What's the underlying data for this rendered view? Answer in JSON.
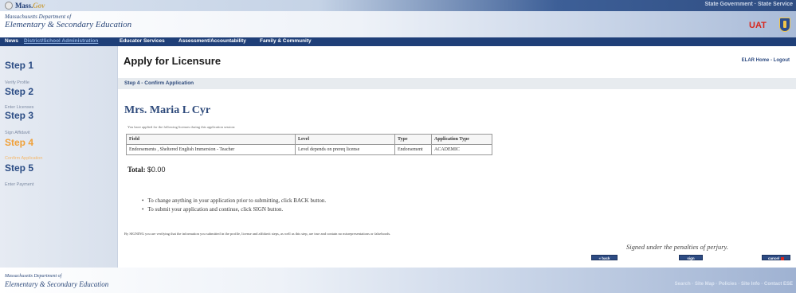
{
  "topbar": {
    "logo_text": "Mass.",
    "logo_accent": "Gov",
    "right_links": "State Government · State Service"
  },
  "header": {
    "dept_line1": "Massachusetts Department of",
    "dept_line2": "Elementary & Secondary Education",
    "env_label": "UAT"
  },
  "nav": {
    "items": [
      "News",
      "District/School Administration",
      "Educator Services",
      "Assessment/Accountability",
      "Family & Community"
    ]
  },
  "sidebar": {
    "steps": [
      {
        "label": "Step 1",
        "active": false
      },
      {
        "label": "Step 2",
        "active": false
      },
      {
        "label": "Step 3",
        "active": false
      },
      {
        "label": "Step 4",
        "active": true
      },
      {
        "label": "Step 5",
        "active": false
      }
    ],
    "sublinks": [
      "Verify Profile",
      "Enter Licenses",
      "Sign Affidavit",
      "Confirm Application",
      "Enter Payment"
    ]
  },
  "main": {
    "title": "Apply for Licensure",
    "links": {
      "home": "ELAR Home",
      "separator": " - ",
      "logout": "Logout"
    },
    "step_label": "Step 4 - Confirm Application",
    "applicant_name": "Mrs. Maria L Cyr",
    "intro": "You have applied for the following licenses during this application session:",
    "table": {
      "headers": [
        "Field",
        "Level",
        "Type",
        "Application Type"
      ],
      "rows": [
        [
          "Endorsements , Sheltered English Immersion - Teacher",
          "Level depends on prereq license",
          "Endorsement",
          "ACADEMIC"
        ]
      ]
    },
    "total_label": "Total:",
    "total_value": "$0.00",
    "instructions": [
      "To change anything in your application prior to submitting, click BACK button.",
      "To submit your application and continue, click SIGN button."
    ],
    "disclaimer": "By SIGNING you are verifying that the information you submitted in the profile, license and affidavit steps, as well as this step, are true and contain no misrepresentations or falsehoods.",
    "signed_text": "Signed under the penalties of perjury.",
    "buttons": {
      "back": "« back",
      "sign": "sign",
      "cancel": "cancel"
    }
  },
  "footer": {
    "dept_line1": "Massachusetts Department of",
    "dept_line2": "Elementary & Secondary Education",
    "links": "Search · Site Map · Policies · Site Info · Contact ESE"
  },
  "colors": {
    "nav_bg": "#1f3f78",
    "brand_blue": "#2e4a7b",
    "active_step": "#f0a13a",
    "uat_red": "#d9261c"
  }
}
